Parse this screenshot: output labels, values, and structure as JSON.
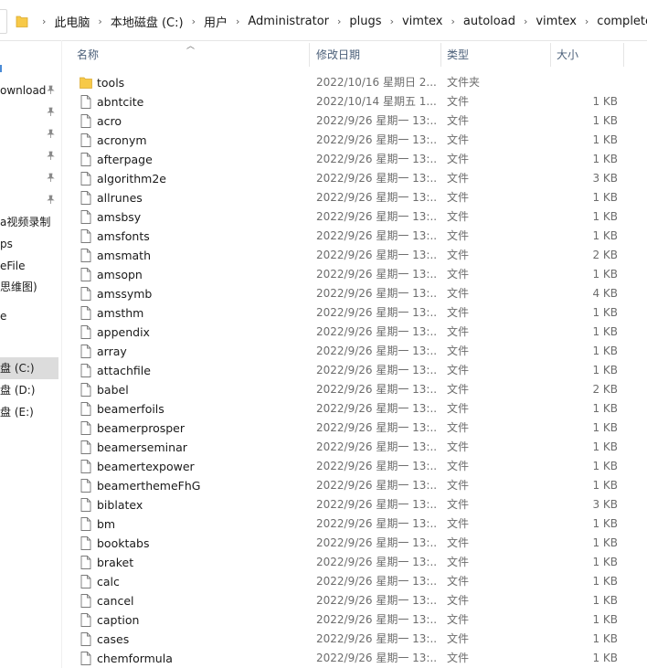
{
  "address_bar": {
    "crumbs": [
      "此电脑",
      "本地磁盘 (C:)",
      "用户",
      "Administrator",
      "plugs",
      "vimtex",
      "autoload",
      "vimtex",
      "complete"
    ]
  },
  "nav_pane": {
    "items": [
      {
        "label": "",
        "pinned": false
      },
      {
        "label": "ownload",
        "pinned": true
      },
      {
        "label": "",
        "pinned": true
      },
      {
        "label": "",
        "pinned": true
      },
      {
        "label": "",
        "pinned": true
      },
      {
        "label": "",
        "pinned": true
      },
      {
        "label": "",
        "pinned": true
      },
      {
        "label": "a视频录制",
        "pinned": false
      },
      {
        "label": "ps",
        "pinned": false
      },
      {
        "label": "eFile",
        "pinned": false
      },
      {
        "label": "思维图)",
        "pinned": false
      },
      {
        "label": "e",
        "pinned": false
      },
      {
        "label": "",
        "pinned": false
      },
      {
        "label": "盘 (C:)",
        "pinned": false,
        "selected": true
      },
      {
        "label": "盘 (D:)",
        "pinned": false
      },
      {
        "label": "盘 (E:)",
        "pinned": false
      }
    ]
  },
  "columns": {
    "name": "名称",
    "date": "修改日期",
    "type": "类型",
    "size": "大小"
  },
  "files": [
    {
      "name": "tools",
      "date": "2022/10/16 星期日 2...",
      "type": "文件夹",
      "size": "",
      "kind": "folder"
    },
    {
      "name": "abntcite",
      "date": "2022/10/14 星期五 1...",
      "type": "文件",
      "size": "1 KB",
      "kind": "file"
    },
    {
      "name": "acro",
      "date": "2022/9/26 星期一 13:...",
      "type": "文件",
      "size": "1 KB",
      "kind": "file"
    },
    {
      "name": "acronym",
      "date": "2022/9/26 星期一 13:...",
      "type": "文件",
      "size": "1 KB",
      "kind": "file"
    },
    {
      "name": "afterpage",
      "date": "2022/9/26 星期一 13:...",
      "type": "文件",
      "size": "1 KB",
      "kind": "file"
    },
    {
      "name": "algorithm2e",
      "date": "2022/9/26 星期一 13:...",
      "type": "文件",
      "size": "3 KB",
      "kind": "file"
    },
    {
      "name": "allrunes",
      "date": "2022/9/26 星期一 13:...",
      "type": "文件",
      "size": "1 KB",
      "kind": "file"
    },
    {
      "name": "amsbsy",
      "date": "2022/9/26 星期一 13:...",
      "type": "文件",
      "size": "1 KB",
      "kind": "file"
    },
    {
      "name": "amsfonts",
      "date": "2022/9/26 星期一 13:...",
      "type": "文件",
      "size": "1 KB",
      "kind": "file"
    },
    {
      "name": "amsmath",
      "date": "2022/9/26 星期一 13:...",
      "type": "文件",
      "size": "2 KB",
      "kind": "file"
    },
    {
      "name": "amsopn",
      "date": "2022/9/26 星期一 13:...",
      "type": "文件",
      "size": "1 KB",
      "kind": "file"
    },
    {
      "name": "amssymb",
      "date": "2022/9/26 星期一 13:...",
      "type": "文件",
      "size": "4 KB",
      "kind": "file"
    },
    {
      "name": "amsthm",
      "date": "2022/9/26 星期一 13:...",
      "type": "文件",
      "size": "1 KB",
      "kind": "file"
    },
    {
      "name": "appendix",
      "date": "2022/9/26 星期一 13:...",
      "type": "文件",
      "size": "1 KB",
      "kind": "file"
    },
    {
      "name": "array",
      "date": "2022/9/26 星期一 13:...",
      "type": "文件",
      "size": "1 KB",
      "kind": "file"
    },
    {
      "name": "attachfile",
      "date": "2022/9/26 星期一 13:...",
      "type": "文件",
      "size": "1 KB",
      "kind": "file"
    },
    {
      "name": "babel",
      "date": "2022/9/26 星期一 13:...",
      "type": "文件",
      "size": "2 KB",
      "kind": "file"
    },
    {
      "name": "beamerfoils",
      "date": "2022/9/26 星期一 13:...",
      "type": "文件",
      "size": "1 KB",
      "kind": "file"
    },
    {
      "name": "beamerprosper",
      "date": "2022/9/26 星期一 13:...",
      "type": "文件",
      "size": "1 KB",
      "kind": "file"
    },
    {
      "name": "beamerseminar",
      "date": "2022/9/26 星期一 13:...",
      "type": "文件",
      "size": "1 KB",
      "kind": "file"
    },
    {
      "name": "beamertexpower",
      "date": "2022/9/26 星期一 13:...",
      "type": "文件",
      "size": "1 KB",
      "kind": "file"
    },
    {
      "name": "beamerthemeFhG",
      "date": "2022/9/26 星期一 13:...",
      "type": "文件",
      "size": "1 KB",
      "kind": "file"
    },
    {
      "name": "biblatex",
      "date": "2022/9/26 星期一 13:...",
      "type": "文件",
      "size": "3 KB",
      "kind": "file"
    },
    {
      "name": "bm",
      "date": "2022/9/26 星期一 13:...",
      "type": "文件",
      "size": "1 KB",
      "kind": "file"
    },
    {
      "name": "booktabs",
      "date": "2022/9/26 星期一 13:...",
      "type": "文件",
      "size": "1 KB",
      "kind": "file"
    },
    {
      "name": "braket",
      "date": "2022/9/26 星期一 13:...",
      "type": "文件",
      "size": "1 KB",
      "kind": "file"
    },
    {
      "name": "calc",
      "date": "2022/9/26 星期一 13:...",
      "type": "文件",
      "size": "1 KB",
      "kind": "file"
    },
    {
      "name": "cancel",
      "date": "2022/9/26 星期一 13:...",
      "type": "文件",
      "size": "1 KB",
      "kind": "file"
    },
    {
      "name": "caption",
      "date": "2022/9/26 星期一 13:...",
      "type": "文件",
      "size": "1 KB",
      "kind": "file"
    },
    {
      "name": "cases",
      "date": "2022/9/26 星期一 13:...",
      "type": "文件",
      "size": "1 KB",
      "kind": "file"
    },
    {
      "name": "chemformula",
      "date": "2022/9/26 星期一 13:...",
      "type": "文件",
      "size": "1 KB",
      "kind": "file"
    }
  ],
  "colors": {
    "folder_yellow": "#f7c948",
    "header_text": "#4c607a",
    "muted_text": "#6d6d6d",
    "selected_bg": "#dcdcdc"
  }
}
